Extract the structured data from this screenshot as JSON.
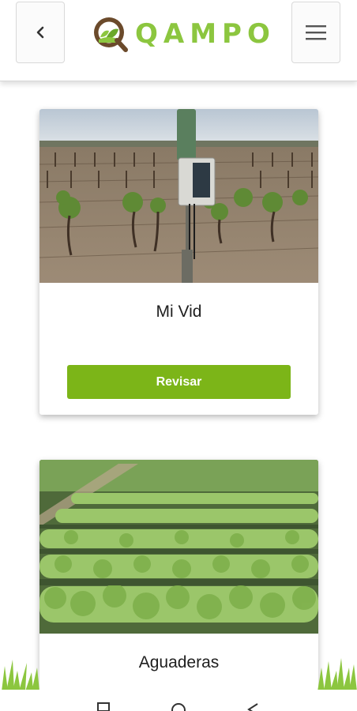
{
  "app": {
    "brand_name": "QAMPO",
    "brand_color": "#8cc63f",
    "accent_color": "#7cb518"
  },
  "header": {
    "back_icon": "chevron-left-icon",
    "menu_icon": "hamburger-menu-icon",
    "logo_icon": "qampo-leaf-logo"
  },
  "cards": [
    {
      "title": "Mi Vid",
      "image": "vineyard-with-weather-station",
      "button_label": "Revisar"
    },
    {
      "title": "Aguaderas",
      "image": "lettuce-field-rows"
    }
  ],
  "system_nav": {
    "icons": [
      "recents-icon",
      "home-icon",
      "back-icon"
    ]
  }
}
